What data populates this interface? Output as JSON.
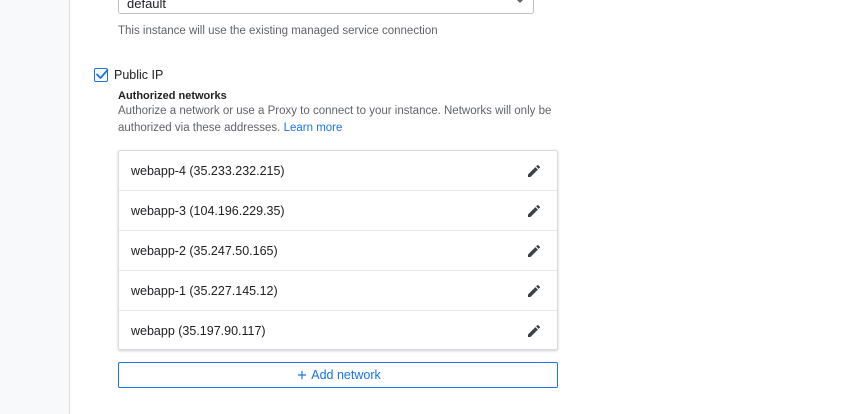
{
  "network_select": {
    "value": "default",
    "hint": "This instance will use the existing managed service connection"
  },
  "public_ip": {
    "label": "Public IP",
    "checked": true
  },
  "authorized_networks": {
    "title": "Authorized networks",
    "description": "Authorize a network or use a Proxy to connect to your instance. Networks will only be authorized via these addresses.",
    "learn_more": "Learn more",
    "items": [
      {
        "label": "webapp-4 (35.233.232.215)"
      },
      {
        "label": "webapp-3 (104.196.229.35)"
      },
      {
        "label": "webapp-2 (35.247.50.165)"
      },
      {
        "label": "webapp-1 (35.227.145.12)"
      },
      {
        "label": "webapp (35.197.90.117)"
      }
    ],
    "add_button": "Add network"
  },
  "icons": {
    "edit": "pencil-icon",
    "add": "plus-icon",
    "checkbox": "check-icon",
    "dropdown": "chevron-down-icon"
  },
  "colors": {
    "accent": "#1a73e8",
    "text": "#202124",
    "muted": "#5f6368",
    "border": "#dadce0"
  }
}
